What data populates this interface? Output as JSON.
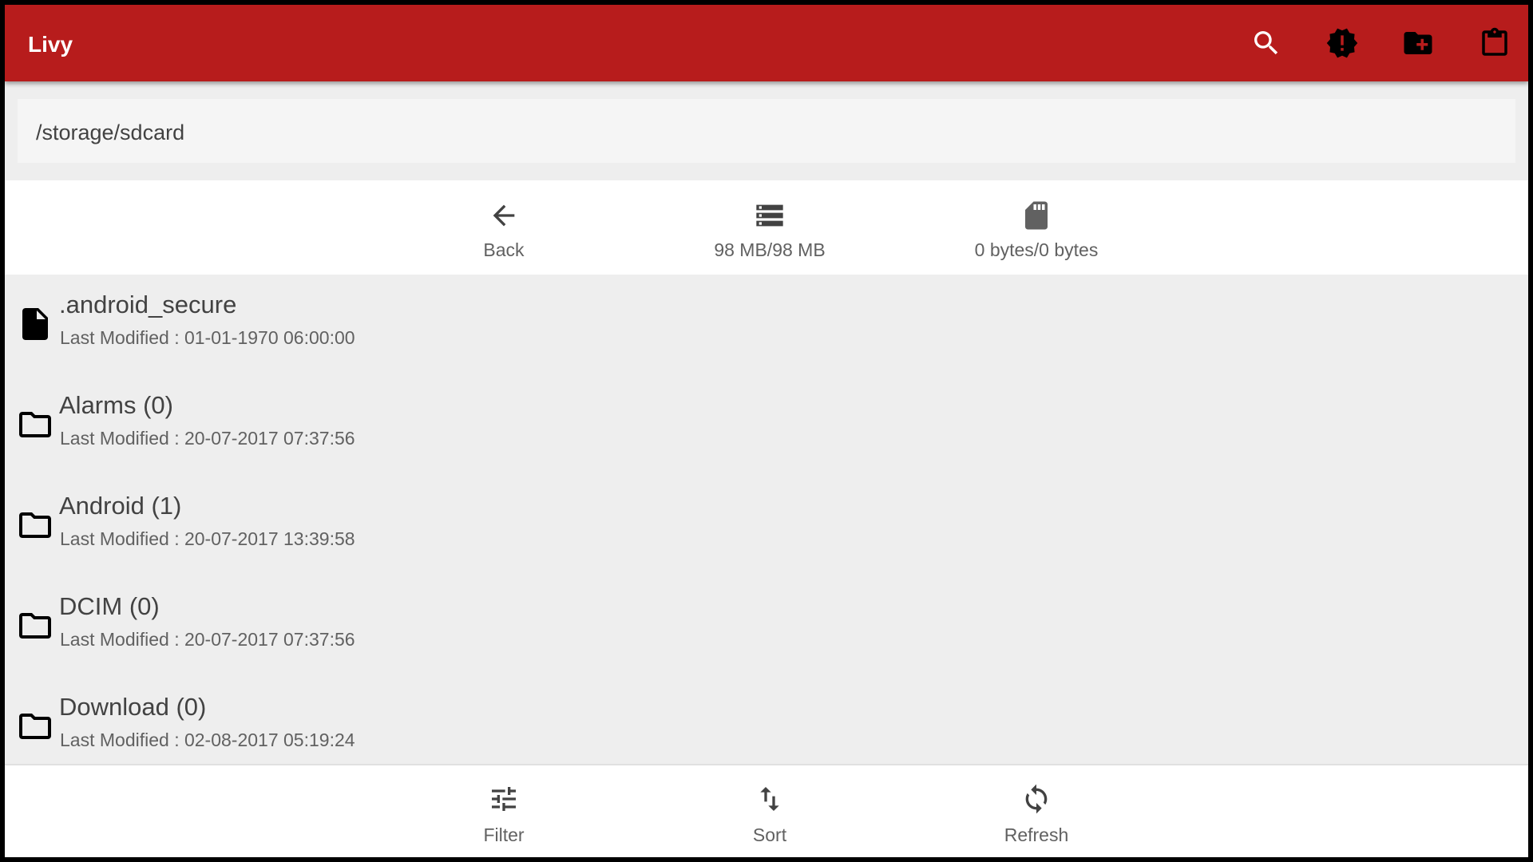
{
  "app": {
    "title": "Livy"
  },
  "appbar": {
    "actions": [
      {
        "name": "search-icon"
      },
      {
        "name": "alert-badge-icon"
      },
      {
        "name": "new-folder-icon"
      },
      {
        "name": "clipboard-icon"
      }
    ]
  },
  "path": {
    "current": "/storage/sdcard"
  },
  "toolbar": {
    "back_label": "Back",
    "internal_storage": "98 MB/98 MB",
    "sd_storage": "0 bytes/0 bytes"
  },
  "files": [
    {
      "name": ".android_secure",
      "meta": "Last Modified : 01-01-1970 06:00:00",
      "type": "file",
      "icon": "file-icon"
    },
    {
      "name": "Alarms (0)",
      "meta": "Last Modified : 20-07-2017 07:37:56",
      "type": "folder",
      "icon": "folder-icon"
    },
    {
      "name": "Android (1)",
      "meta": "Last Modified : 20-07-2017 13:39:58",
      "type": "folder",
      "icon": "folder-icon"
    },
    {
      "name": "DCIM (0)",
      "meta": "Last Modified : 20-07-2017 07:37:56",
      "type": "folder",
      "icon": "folder-icon"
    },
    {
      "name": "Download (0)",
      "meta": "Last Modified : 02-08-2017 05:19:24",
      "type": "folder",
      "icon": "folder-icon"
    }
  ],
  "bottombar": {
    "filter_label": "Filter",
    "sort_label": "Sort",
    "refresh_label": "Refresh"
  },
  "colors": {
    "appbar": "#b71c1c",
    "list_background": "#eeeeee",
    "text_primary": "#424242",
    "text_secondary": "#616161"
  }
}
